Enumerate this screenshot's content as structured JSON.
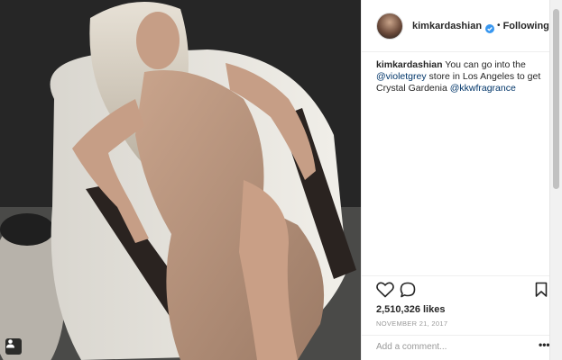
{
  "post": {
    "username": "kimkardashian",
    "verified": true,
    "follow_status": "Following",
    "caption": {
      "user": "kimkardashian",
      "text_1": " You can go into the ",
      "mention_1": "@violetgrey",
      "text_2": " store in Los Angeles to get Crystal Gardenia ",
      "mention_2": "@kkwfragrance"
    },
    "likes": "2,510,326 likes",
    "date": "NOVEMBER 21, 2017",
    "comment_placeholder": "Add a comment...",
    "more_label": "•••"
  },
  "icons": {
    "like": "heart-icon",
    "comment": "comment-bubble-icon",
    "save": "bookmark-icon",
    "tagged": "user-tag-icon",
    "verified": "verified-badge-icon"
  },
  "colors": {
    "mention": "#003569",
    "verified": "#3897f0",
    "text": "#262626",
    "muted": "#999999"
  }
}
